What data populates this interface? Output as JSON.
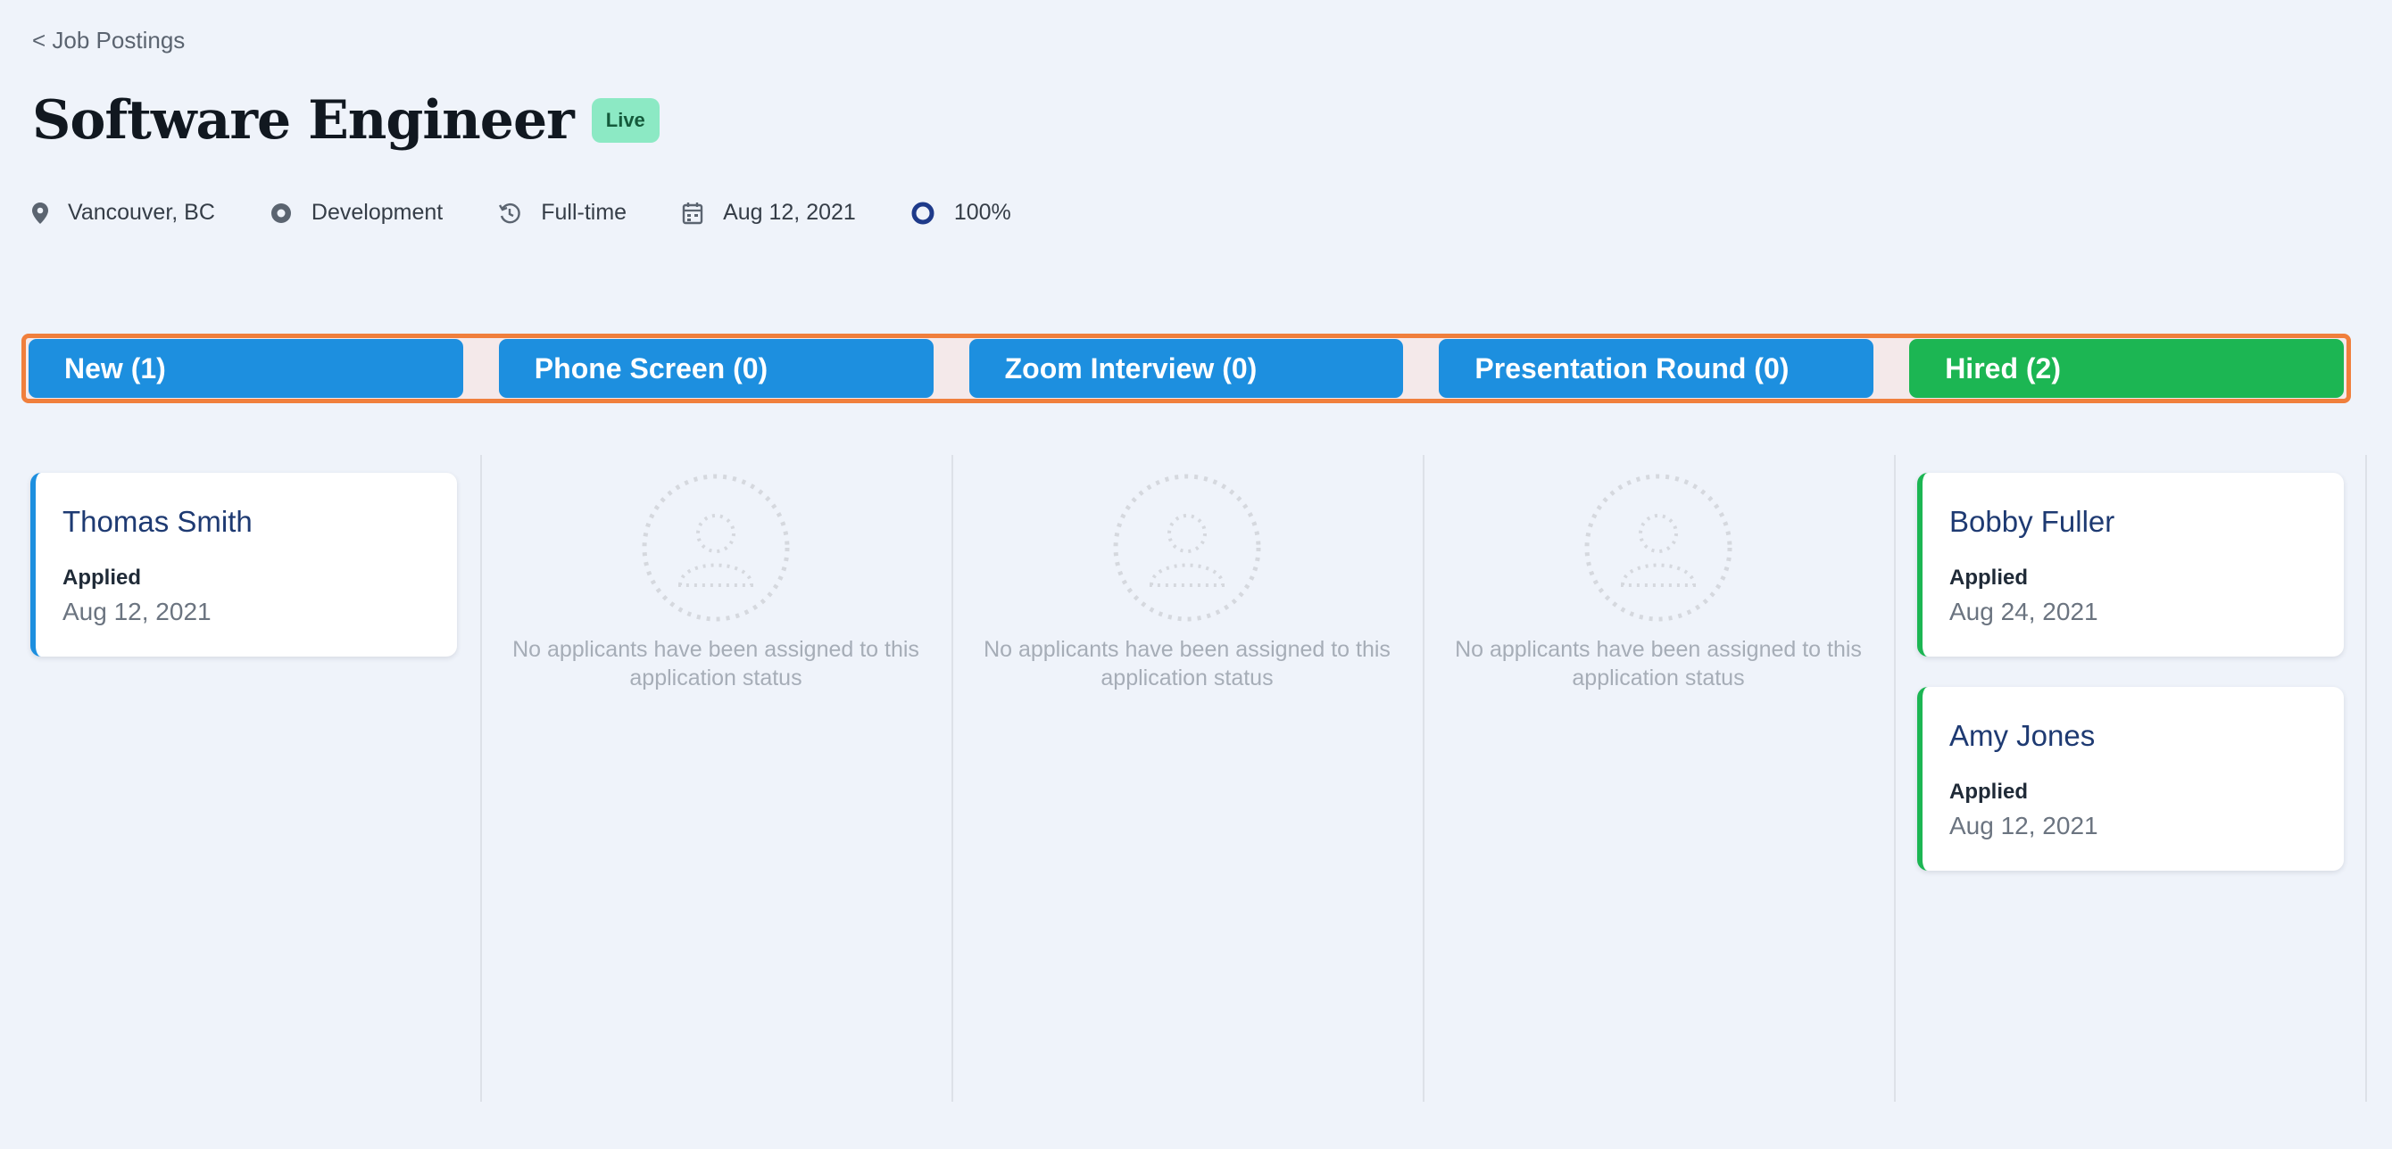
{
  "nav": {
    "back_label": "< Job Postings"
  },
  "job": {
    "title": "Software Engineer",
    "status_badge": "Live",
    "location": "Vancouver, BC",
    "department": "Development",
    "employment_type": "Full-time",
    "posted_date": "Aug 12, 2021",
    "completion": "100%"
  },
  "stages": [
    {
      "label": "New (1)",
      "color": "#1d8fdf"
    },
    {
      "label": "Phone Screen (0)",
      "color": "#1d8fdf"
    },
    {
      "label": "Zoom Interview (0)",
      "color": "#1d8fdf"
    },
    {
      "label": "Presentation Round (0)",
      "color": "#1d8fdf"
    },
    {
      "label": "Hired (2)",
      "color": "#1cb653"
    }
  ],
  "columns": {
    "new": [
      {
        "name": "Thomas Smith",
        "label": "Applied",
        "date": "Aug 12, 2021"
      }
    ],
    "phone_screen": {
      "empty_message": "No applicants have been assigned to this application status"
    },
    "zoom_interview": {
      "empty_message": "No applicants have been assigned to this application status"
    },
    "presentation_round": {
      "empty_message": "No applicants have been assigned to this application status"
    },
    "hired": [
      {
        "name": "Bobby Fuller",
        "label": "Applied",
        "date": "Aug 24, 2021"
      },
      {
        "name": "Amy Jones",
        "label": "Applied",
        "date": "Aug 12, 2021"
      }
    ]
  }
}
